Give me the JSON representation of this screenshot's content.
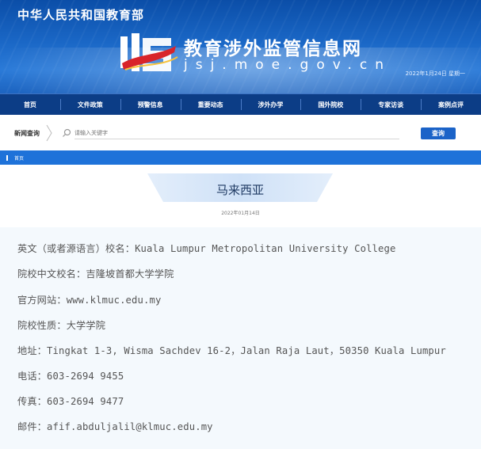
{
  "header": {
    "ministry": "中华人民共和国教育部",
    "site_title": "教育涉外监管信息网",
    "site_domain": "jsj.moe.gov.cn",
    "date": "2022年1月24日  星期一"
  },
  "nav": {
    "items": [
      {
        "label": "首页"
      },
      {
        "label": "文件政策"
      },
      {
        "label": "预警信息"
      },
      {
        "label": "重要动态"
      },
      {
        "label": "涉外办学"
      },
      {
        "label": "国外院校"
      },
      {
        "label": "专家访谈"
      },
      {
        "label": "案例点评"
      }
    ]
  },
  "search": {
    "label": "新闻查询",
    "placeholder": "请输入关键字",
    "button": "查询"
  },
  "breadcrumb": {
    "home": "首页"
  },
  "article": {
    "title": "马来西亚",
    "date": "2022年01月14日"
  },
  "details": [
    {
      "label": "英文（或者源语言）校名：",
      "value": "Kuala Lumpur Metropolitan University College"
    },
    {
      "label": "院校中文校名：",
      "value": "吉隆坡首都大学学院"
    },
    {
      "label": "官方网站：",
      "value": "www.klmuc.edu.my"
    },
    {
      "label": "院校性质：",
      "value": "大学学院"
    },
    {
      "label": "地址：",
      "value": "Tingkat 1-3, Wisma Sachdev 16-2，Jalan Raja Laut，50350 Kuala Lumpur"
    },
    {
      "label": "电话：",
      "value": "603-2694 9455"
    },
    {
      "label": "传真：",
      "value": "603-2694 9477"
    },
    {
      "label": "邮件：",
      "value": "afif.abduljalil@klmuc.edu.my"
    }
  ],
  "colors": {
    "banner": "#1a67c6",
    "nav": "#0c3d86",
    "accent": "#1e72d9",
    "content_bg": "#f4f9fd"
  }
}
